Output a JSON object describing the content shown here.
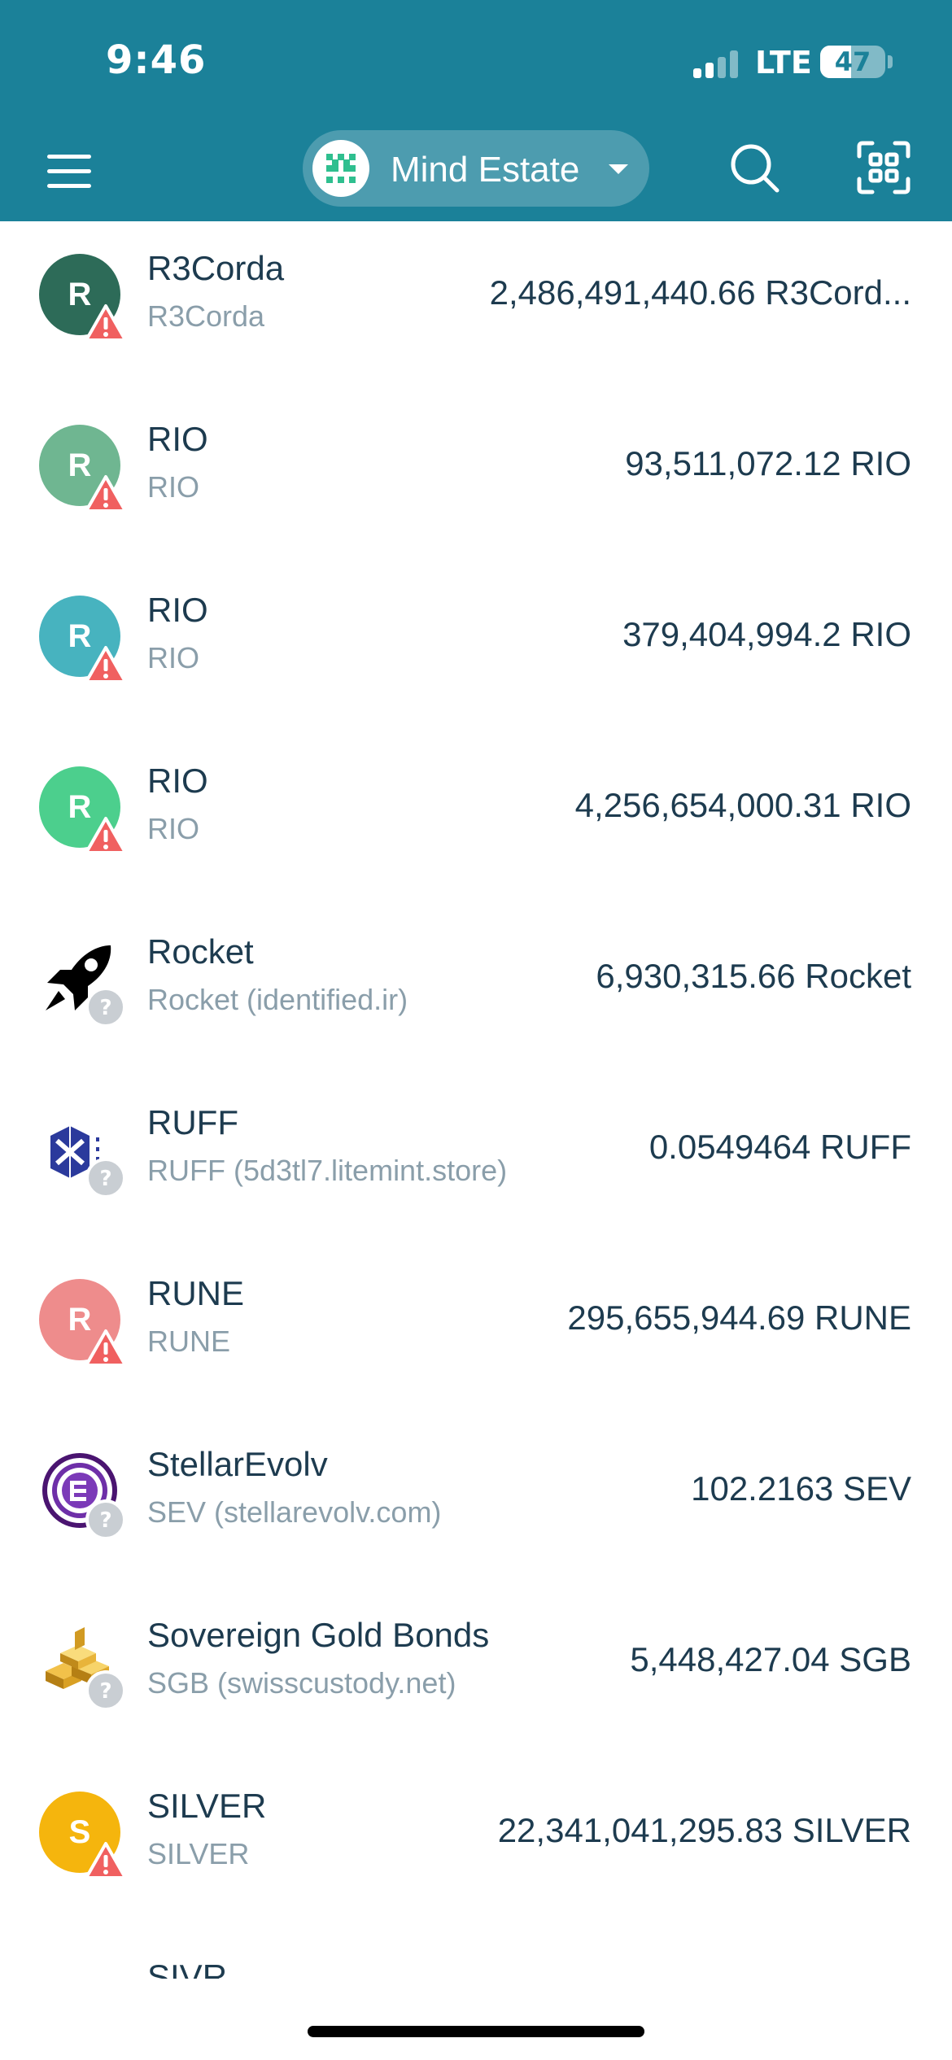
{
  "status_bar": {
    "time": "9:46",
    "network": "LTE",
    "battery": "47",
    "battery_level": 0.47
  },
  "app_bar": {
    "account_name": "Mind Estate",
    "menu_icon": "hamburger-menu-icon",
    "search_icon": "search-icon",
    "scan_icon": "qr-scan-icon"
  },
  "colors": {
    "header": "#1b8199",
    "text_primary": "#1d3b4f",
    "text_secondary": "#8a9eaa",
    "warning": "#f06060",
    "unknown_badge": "#c9ced3"
  },
  "assets": [
    {
      "name": "R3Corda",
      "issuer": "R3Corda",
      "balance": "2,486,491,440.66 R3Cord...",
      "icon_letter": "R",
      "icon_color": "#2d6b58",
      "badge": "warning"
    },
    {
      "name": "RIO",
      "issuer": "RIO",
      "balance": "93,511,072.12 RIO",
      "icon_letter": "R",
      "icon_color": "#6fb691",
      "badge": "warning"
    },
    {
      "name": "RIO",
      "issuer": "RIO",
      "balance": "379,404,994.2 RIO",
      "icon_letter": "R",
      "icon_color": "#47b3bf",
      "badge": "warning"
    },
    {
      "name": "RIO",
      "issuer": "RIO",
      "balance": "4,256,654,000.31 RIO",
      "icon_letter": "R",
      "icon_color": "#4ccf8d",
      "badge": "warning"
    },
    {
      "name": "Rocket",
      "issuer": "Rocket (identified.ir)",
      "balance": "6,930,315.66 Rocket",
      "icon_type": "rocket-logo-icon",
      "badge": "unknown"
    },
    {
      "name": "RUFF",
      "issuer": "RUFF (5d3tl7.litemint.store)",
      "balance": "0.0549464 RUFF",
      "icon_type": "ruff-logo-icon",
      "badge": "unknown"
    },
    {
      "name": "RUNE",
      "issuer": "RUNE",
      "balance": "295,655,944.69 RUNE",
      "icon_letter": "R",
      "icon_color": "#ee8c8c",
      "badge": "warning"
    },
    {
      "name": "StellarEvolv",
      "issuer": "SEV (stellarevolv.com)",
      "balance": "102.2163 SEV",
      "icon_type": "stellarevolv-logo-icon",
      "badge": "unknown"
    },
    {
      "name": "Sovereign Gold Bonds",
      "issuer": "SGB (swisscustody.net)",
      "balance": "5,448,427.04 SGB",
      "icon_type": "gold-bars-logo-icon",
      "badge": "unknown"
    },
    {
      "name": "SILVER",
      "issuer": "SILVER",
      "balance": "22,341,041,295.83 SILVER",
      "icon_letter": "S",
      "icon_color": "#f5b50d",
      "badge": "warning"
    },
    {
      "name": "SIVR",
      "issuer": "",
      "balance": "",
      "icon_type": "sivr-logo-icon",
      "badge": "none"
    }
  ]
}
